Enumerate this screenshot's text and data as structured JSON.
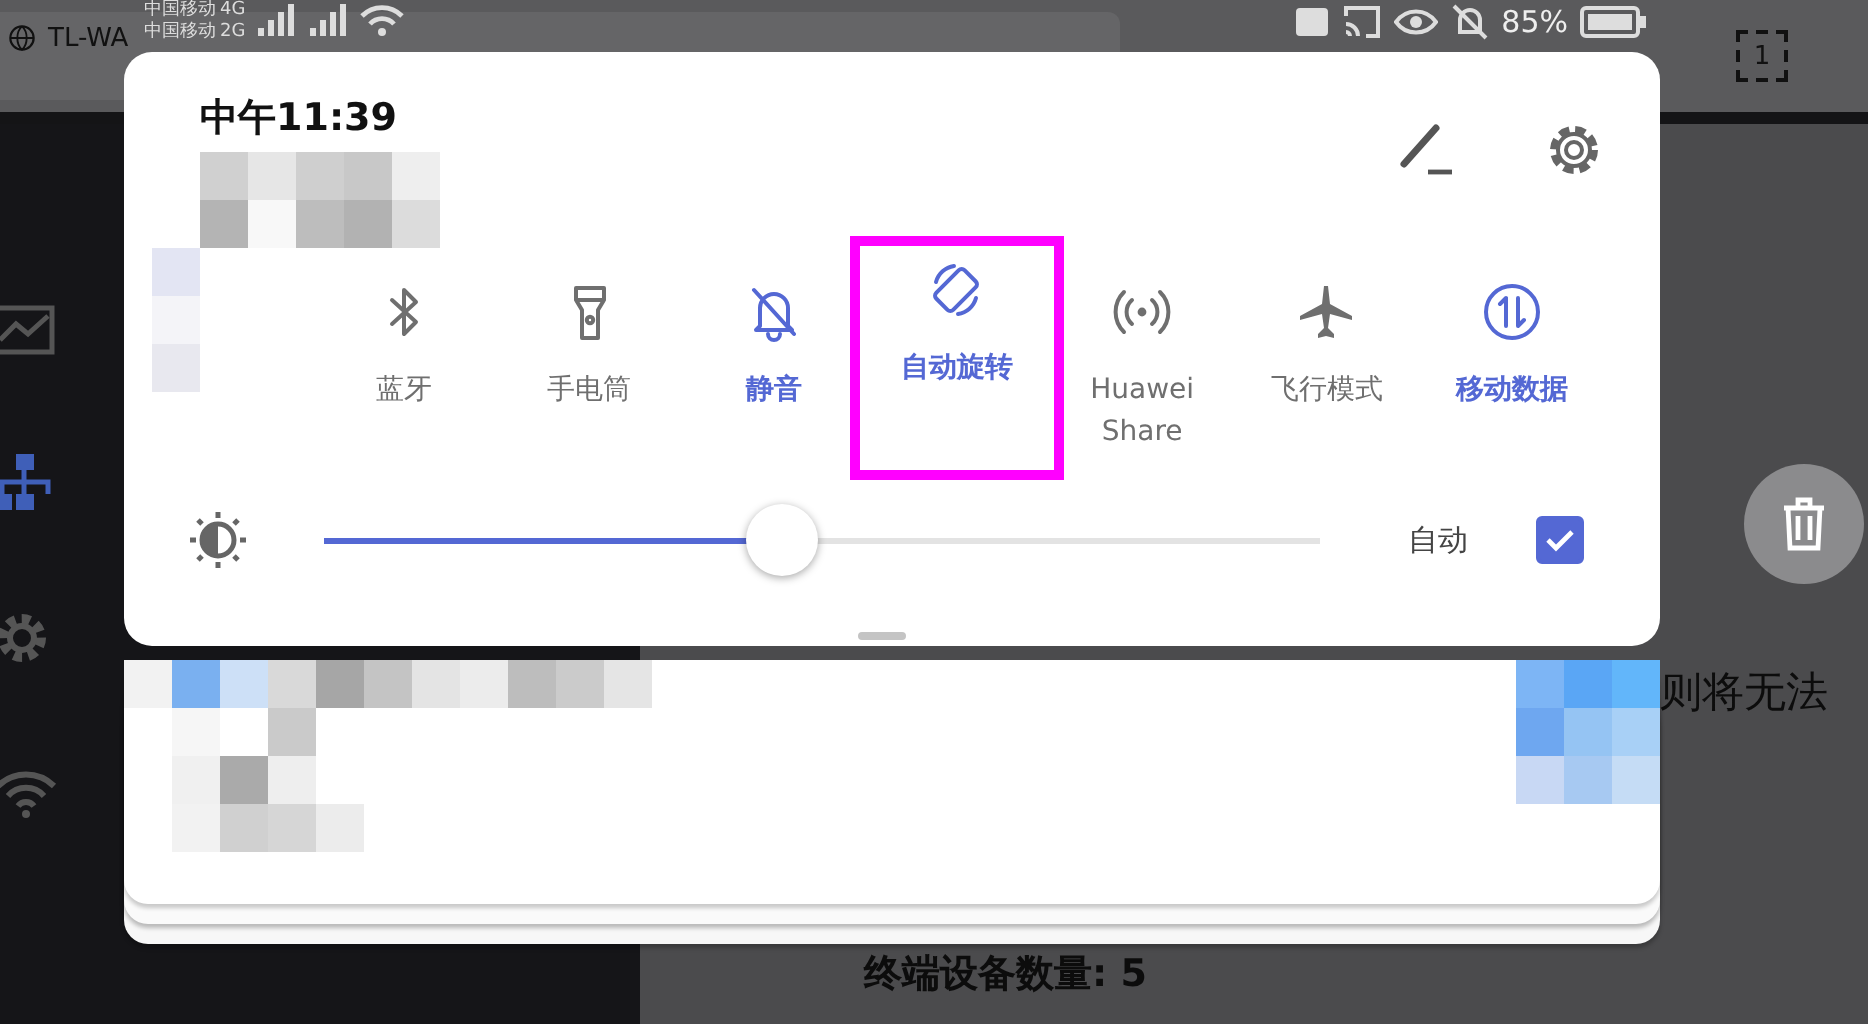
{
  "status_bar": {
    "carriers": [
      {
        "name": "中国移动",
        "network": "4G"
      },
      {
        "name": "中国移动",
        "network": "2G"
      }
    ],
    "battery": "85%"
  },
  "background": {
    "address": "TL-WA",
    "tab_count": "1",
    "notice": "则将无法",
    "device_count": "终端设备数量: 5"
  },
  "quick_panel": {
    "time": "中午11:39",
    "tiles": [
      {
        "label": "蓝牙",
        "kind": "bluetooth",
        "active": false,
        "highlighted": false
      },
      {
        "label": "手电筒",
        "kind": "flashlight",
        "active": false,
        "highlighted": false
      },
      {
        "label": "静音",
        "kind": "mute",
        "active": true,
        "highlighted": false
      },
      {
        "label": "自动旋转",
        "kind": "rotate",
        "active": true,
        "highlighted": true
      },
      {
        "label": "Huawei Share",
        "kind": "share",
        "active": false,
        "highlighted": false
      },
      {
        "label": "飞行模式",
        "kind": "airplane",
        "active": false,
        "highlighted": false
      },
      {
        "label": "移动数据",
        "kind": "data",
        "active": true,
        "highlighted": false
      }
    ],
    "brightness": {
      "level": 0.46,
      "auto_label": "自动",
      "auto_checked": true
    }
  }
}
